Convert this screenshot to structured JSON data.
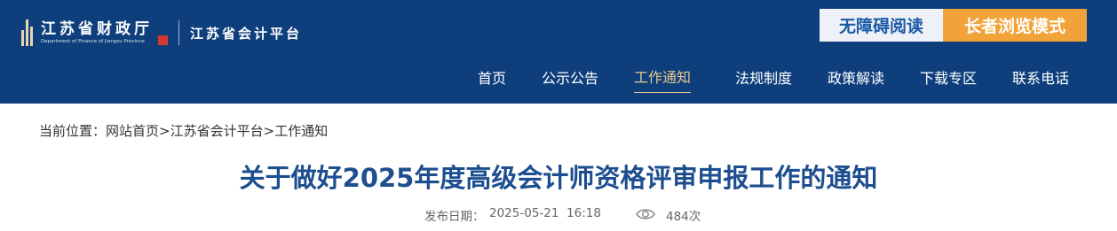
{
  "header": {
    "logo_cn": "江苏省财政厅",
    "logo_en": "Department of Finance of Jiangsu Province",
    "subsite": "江苏省会计平台",
    "accessible_label": "无障碍阅读",
    "elder_label": "长者浏览模式",
    "colors": {
      "background": "#0e3f7c",
      "accent": "#f1a33a",
      "active_nav": "#e7c98d"
    }
  },
  "nav": {
    "items": [
      {
        "label": "首页"
      },
      {
        "label": "公示公告"
      },
      {
        "label": "工作通知",
        "active": true
      },
      {
        "label": "法规制度"
      },
      {
        "label": "政策解读"
      },
      {
        "label": "下载专区"
      },
      {
        "label": "联系电话"
      }
    ]
  },
  "breadcrumb": {
    "prefix": "当前位置：",
    "home": "网站首页",
    "sep1": ">",
    "level1": "江苏省会计平台",
    "sep2": ">",
    "level2": "工作通知"
  },
  "article": {
    "title": "关于做好2025年度高级会计师资格评审申报工作的通知",
    "date_label": "发布日期：",
    "date_value": "2025-05-21  16:18",
    "view_icon": "eye-icon",
    "views": "484次"
  }
}
